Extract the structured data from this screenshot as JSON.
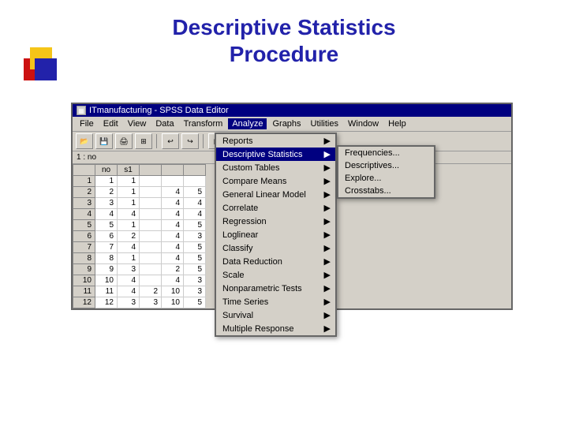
{
  "title": {
    "line1": "Descriptive Statistics",
    "line2": "Procedure"
  },
  "spss_window": {
    "title_bar": "ITmanufacturing - SPSS Data Editor",
    "menu_items": [
      "File",
      "Edit",
      "View",
      "Data",
      "Transform",
      "Analyze",
      "Graphs",
      "Utilities",
      "Window",
      "Help"
    ],
    "row_indicator": "1 : no"
  },
  "data_table": {
    "headers": [
      "",
      "no",
      "s1",
      "",
      "",
      ""
    ],
    "rows": [
      {
        "row": 1,
        "no": 1,
        "s1": 1,
        "c3": "",
        "c4": "",
        "c5": ""
      },
      {
        "row": 2,
        "no": 2,
        "s1": 1,
        "c3": "",
        "c4": 4,
        "c5": 5
      },
      {
        "row": 3,
        "no": 3,
        "s1": 1,
        "c3": "",
        "c4": 4,
        "c5": 4
      },
      {
        "row": 4,
        "no": 4,
        "s1": 4,
        "c3": "",
        "c4": 4,
        "c5": 4
      },
      {
        "row": 5,
        "no": 5,
        "s1": 1,
        "c3": "",
        "c4": 4,
        "c5": 5
      },
      {
        "row": 6,
        "no": 6,
        "s1": 2,
        "c3": "",
        "c4": 4,
        "c5": 3
      },
      {
        "row": 7,
        "no": 7,
        "s1": 4,
        "c3": "",
        "c4": 4,
        "c5": 5
      },
      {
        "row": 8,
        "no": 8,
        "s1": 1,
        "c3": "",
        "c4": 4,
        "c5": 5
      },
      {
        "row": 9,
        "no": 9,
        "s1": 3,
        "c3": "",
        "c4": 2,
        "c5": 5
      },
      {
        "row": 10,
        "no": 10,
        "s1": 4,
        "c3": "",
        "c4": 4,
        "c5": 3
      },
      {
        "row": 11,
        "no": 11,
        "s1": 4,
        "c3": 2,
        "c4": 10,
        "c5": 3
      },
      {
        "row": 12,
        "no": 12,
        "s1": 3,
        "c3": 3,
        "c4": 10,
        "c5": 5
      }
    ]
  },
  "analyze_menu": {
    "items": [
      {
        "label": "Reports",
        "arrow": true
      },
      {
        "label": "Descriptive Statistics",
        "arrow": true,
        "active": true
      },
      {
        "label": "Custom Tables",
        "arrow": true
      },
      {
        "label": "Compare Means",
        "arrow": true
      },
      {
        "label": "General Linear Model",
        "arrow": true
      },
      {
        "label": "Correlate",
        "arrow": true
      },
      {
        "label": "Regression",
        "arrow": true
      },
      {
        "label": "Loglinear",
        "arrow": true
      },
      {
        "label": "Classify",
        "arrow": true
      },
      {
        "label": "Data Reduction",
        "arrow": true
      },
      {
        "label": "Scale",
        "arrow": true
      },
      {
        "label": "Nonparametric Tests",
        "arrow": true
      },
      {
        "label": "Time Series",
        "arrow": true
      },
      {
        "label": "Survival",
        "arrow": true
      },
      {
        "label": "Multiple Response",
        "arrow": true
      }
    ]
  },
  "descriptive_submenu": {
    "items": [
      {
        "label": "Frequencies..."
      },
      {
        "label": "Descriptives..."
      },
      {
        "label": "Explore..."
      },
      {
        "label": "Crosstabs..."
      }
    ]
  }
}
